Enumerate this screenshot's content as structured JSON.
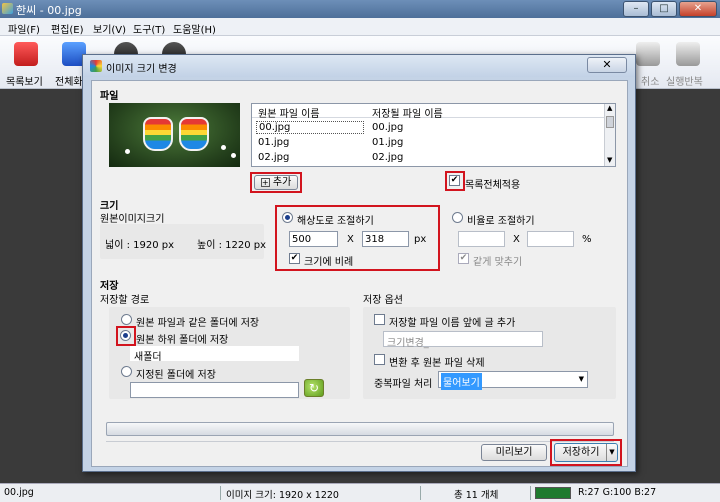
{
  "app": {
    "title": "한씨 - 00.jpg",
    "window_controls": [
      "minimize-icon",
      "maximize-icon",
      "close-icon"
    ]
  },
  "menu": [
    "파일(F)",
    "편집(E)",
    "보기(V)",
    "도구(T)",
    "도움말(H)"
  ],
  "toolbar": {
    "left_labels": [
      "목록보기",
      "전체화"
    ],
    "right_labels": [
      "취소",
      "실행반복"
    ]
  },
  "dialog": {
    "title": "이미지 크기 변경",
    "file_section": {
      "header": "파일",
      "col_original": "원본 파일 이름",
      "col_saved": "저장될 파일 이름",
      "rows": [
        [
          "00.jpg",
          "00.jpg"
        ],
        [
          "01.jpg",
          "01.jpg"
        ],
        [
          "02.jpg",
          "02.jpg"
        ]
      ],
      "add_button": "추가",
      "apply_all_label": "목록전체적용",
      "apply_all_checked": true
    },
    "size_section": {
      "header": "크기",
      "original_label": "원본이미지크기",
      "original_width": "넓이 :   1920 px",
      "original_height": "높이 : 1220 px",
      "resolution_label": "해상도로 조절하기",
      "width_value": "500",
      "height_value": "318",
      "x_sep": "X",
      "unit_px": "px",
      "proportional_label": "크기에 비례",
      "proportional_checked": true,
      "ratio_label": "비율로 조절하기",
      "unit_pct": "%",
      "same_ratio_label": "같게 맞추기"
    },
    "save_section": {
      "header": "저장",
      "path_header": "저장할 경로",
      "opt_same_folder": "원본 파일과 같은 폴더에 저장",
      "opt_sub_folder": "원본 하위 폴더에 저장",
      "sub_folder_value": "새폴더",
      "opt_specified": "지정된 폴더에 저장",
      "options_header": "저장 옵션",
      "prefix_label": "저장할 파일 이름 앞에 글 추가",
      "prefix_value": "크기변경_",
      "delete_label": "변환 후 원본 파일 삭제",
      "dup_label": "중복파일 처리",
      "dup_value": "물어보기"
    },
    "preview_button": "미리보기",
    "save_button": "저장하기"
  },
  "status": {
    "filename": "00.jpg",
    "image_size": "이미지 크기: 1920 x 1220",
    "total": "총 11 개체",
    "swatch_color": "#1f7a2e",
    "rgb": "R:27 G:100 B:27"
  },
  "colors": {
    "highlight": "#d2141e",
    "selection": "#3399ff"
  }
}
